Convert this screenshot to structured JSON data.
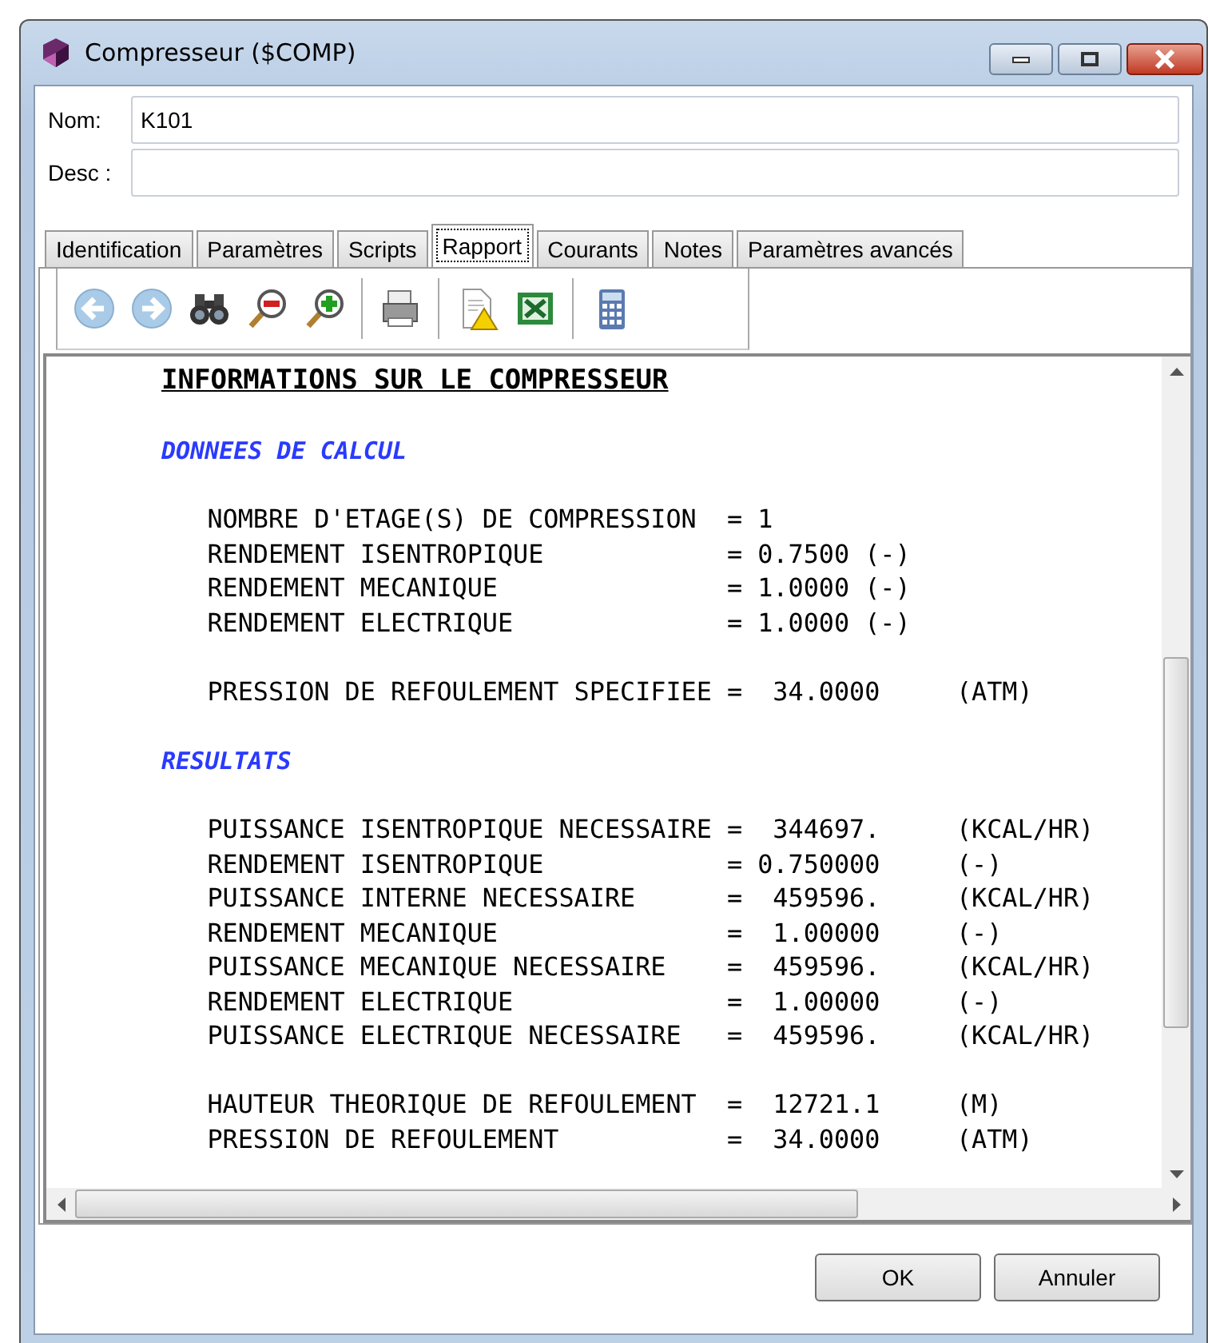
{
  "window": {
    "title": "Compresseur ($COMP)"
  },
  "fields": [
    {
      "label": "Nom:",
      "value": "K101"
    },
    {
      "label": "Desc :"
    }
  ],
  "tabs": [
    {
      "label": "Identification",
      "selected": false
    },
    {
      "label": "Paramètres",
      "selected": false
    },
    {
      "label": "Scripts",
      "selected": false
    },
    {
      "label": "Rapport",
      "selected": true
    },
    {
      "label": "Courants",
      "selected": false
    },
    {
      "label": "Notes",
      "selected": false
    },
    {
      "label": "Paramètres avancés",
      "selected": false
    }
  ],
  "toolbar": [
    {
      "kind": "back"
    },
    {
      "kind": "forward"
    },
    {
      "kind": "binoculars"
    },
    {
      "kind": "zoom-out"
    },
    {
      "kind": "zoom-in"
    },
    {
      "kind": "sep"
    },
    {
      "kind": "printer"
    },
    {
      "kind": "sep"
    },
    {
      "kind": "warning-doc"
    },
    {
      "kind": "spreadsheet"
    },
    {
      "kind": "sep"
    },
    {
      "kind": "calculator"
    }
  ],
  "report": [
    {
      "kind": "title",
      "text": "INFORMATIONS SUR LE COMPRESSEUR"
    },
    {
      "kind": "gap"
    },
    {
      "kind": "section",
      "text": "DONNEES DE CALCUL"
    },
    {
      "kind": "gap"
    },
    {
      "kind": "line",
      "text": "   NOMBRE D'ETAGE(S) DE COMPRESSION  = 1"
    },
    {
      "kind": "line",
      "text": "   RENDEMENT ISENTROPIQUE            = 0.7500 (-)"
    },
    {
      "kind": "line",
      "text": "   RENDEMENT MECANIQUE               = 1.0000 (-)"
    },
    {
      "kind": "line",
      "text": "   RENDEMENT ELECTRIQUE              = 1.0000 (-)"
    },
    {
      "kind": "gap"
    },
    {
      "kind": "line",
      "text": "   PRESSION DE REFOULEMENT SPECIFIEE =  34.0000     (ATM)"
    },
    {
      "kind": "gap"
    },
    {
      "kind": "section",
      "text": "RESULTATS"
    },
    {
      "kind": "gap"
    },
    {
      "kind": "line",
      "text": "   PUISSANCE ISENTROPIQUE NECESSAIRE =  344697.     (KCAL/HR)"
    },
    {
      "kind": "line",
      "text": "   RENDEMENT ISENTROPIQUE            = 0.750000     (-)"
    },
    {
      "kind": "line",
      "text": "   PUISSANCE INTERNE NECESSAIRE      =  459596.     (KCAL/HR)"
    },
    {
      "kind": "line",
      "text": "   RENDEMENT MECANIQUE               =  1.00000     (-)"
    },
    {
      "kind": "line",
      "text": "   PUISSANCE MECANIQUE NECESSAIRE    =  459596.     (KCAL/HR)"
    },
    {
      "kind": "line",
      "text": "   RENDEMENT ELECTRIQUE              =  1.00000     (-)"
    },
    {
      "kind": "line",
      "text": "   PUISSANCE ELECTRIQUE NECESSAIRE   =  459596.     (KCAL/HR)"
    },
    {
      "kind": "gap"
    },
    {
      "kind": "line",
      "text": "   HAUTEUR THEORIQUE DE REFOULEMENT  =  12721.1     (M)"
    },
    {
      "kind": "line",
      "text": "   PRESSION DE REFOULEMENT           =  34.0000     (ATM)"
    }
  ],
  "buttons": [
    "OK",
    "Annuler"
  ]
}
